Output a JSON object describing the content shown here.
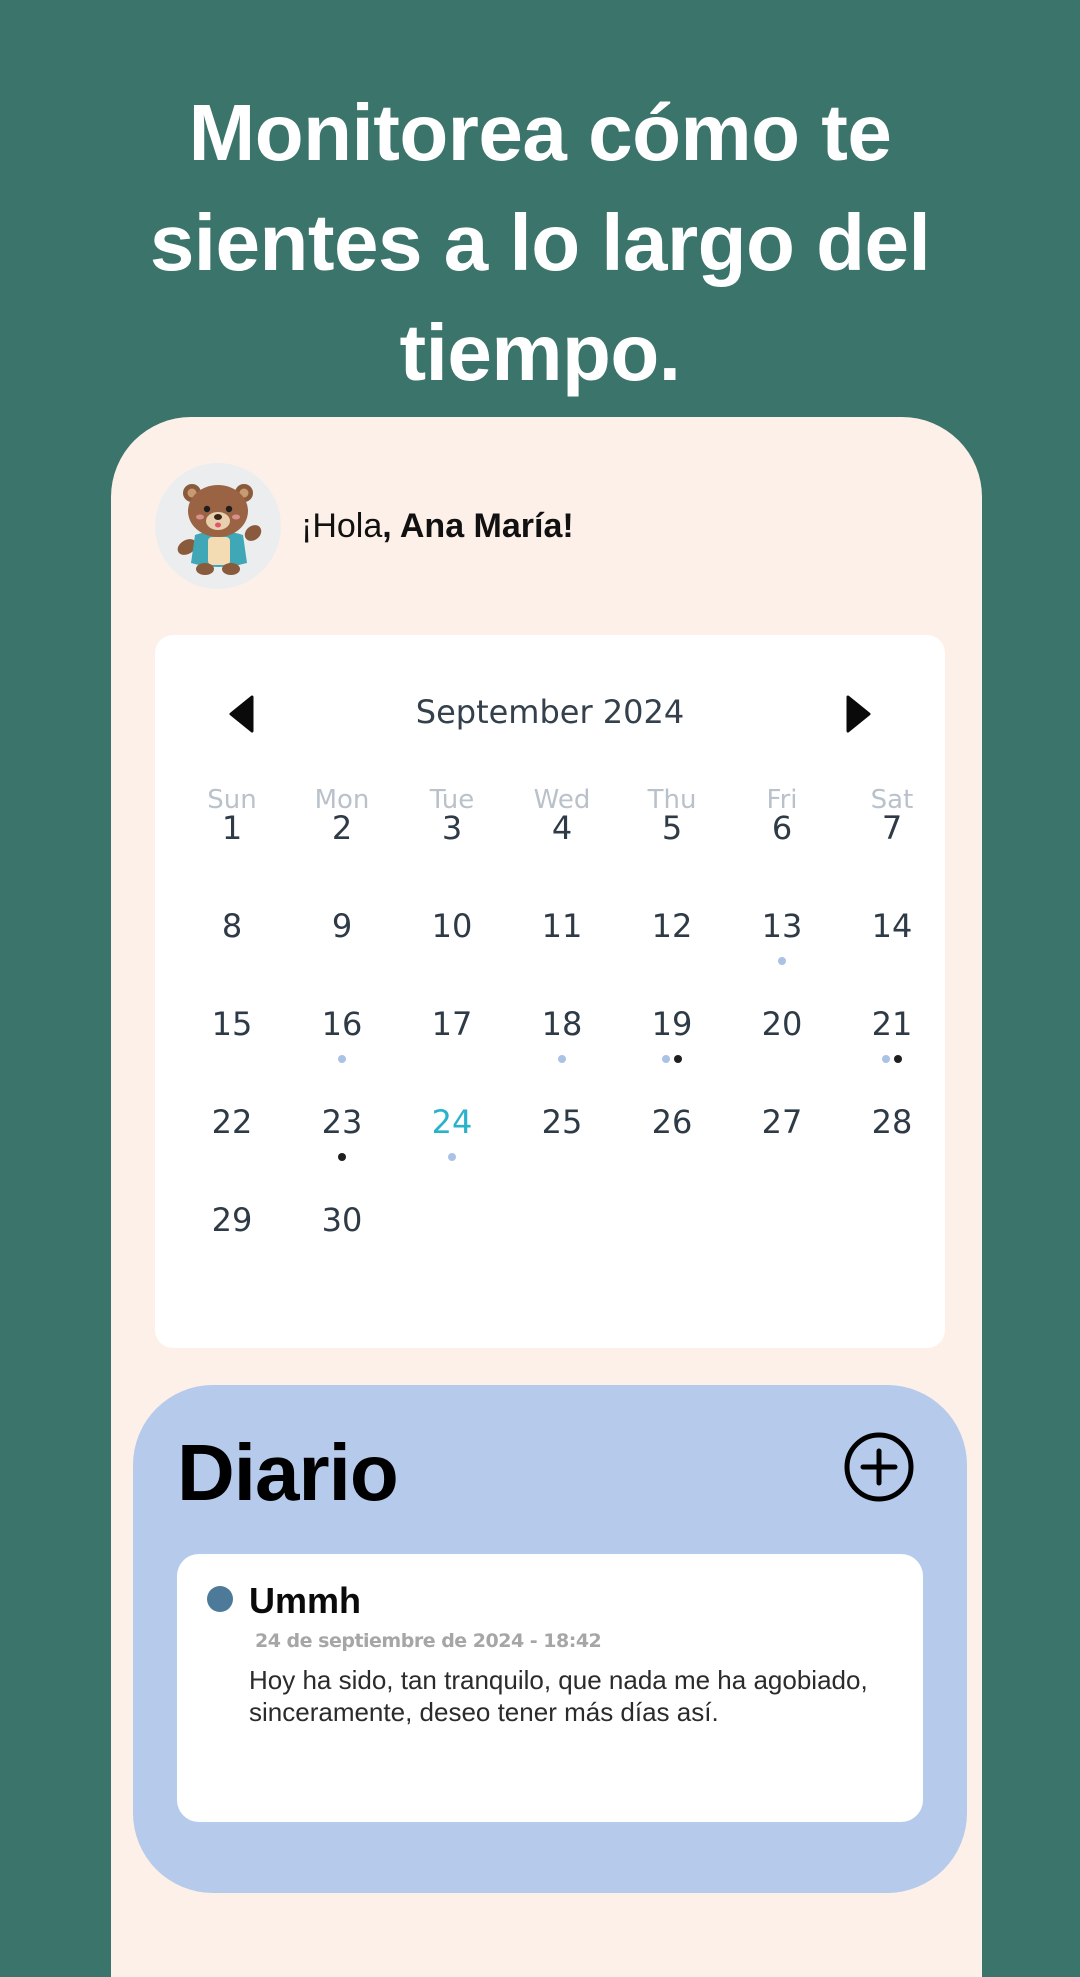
{
  "headline": "Monitorea cómo te sientes a lo largo del tiempo.",
  "greeting": {
    "prefix": "¡Hola",
    "name": ", Ana María!"
  },
  "calendar": {
    "month_label": "September 2024",
    "prev_icon": "caret-left-icon",
    "next_icon": "caret-right-icon",
    "weekdays": [
      "Sun",
      "Mon",
      "Tue",
      "Wed",
      "Thu",
      "Fri",
      "Sat"
    ],
    "weeks": [
      [
        "1",
        "2",
        "3",
        "4",
        "5",
        "6",
        "7"
      ],
      [
        "8",
        "9",
        "10",
        "11",
        "12",
        "13",
        "14"
      ],
      [
        "15",
        "16",
        "17",
        "18",
        "19",
        "20",
        "21"
      ],
      [
        "22",
        "23",
        "24",
        "25",
        "26",
        "27",
        "28"
      ],
      [
        "29",
        "30",
        "",
        "",
        "",
        "",
        ""
      ]
    ],
    "today": "24",
    "markers": {
      "13": [
        "light"
      ],
      "16": [
        "light"
      ],
      "18": [
        "light"
      ],
      "19": [
        "light",
        "dark"
      ],
      "21": [
        "light",
        "dark"
      ],
      "23": [
        "dark"
      ],
      "24": [
        "light"
      ]
    },
    "colors": {
      "today": "#2bb2cb",
      "marker_light": "#a9c2e6",
      "marker_dark": "#1f1f1f"
    }
  },
  "diario": {
    "title": "Diario",
    "add_icon": "plus-circle-icon",
    "entries": [
      {
        "title": "Ummh",
        "date": "24 de septiembre de 2024 - 18:42",
        "text": "Hoy ha sido, tan tranquilo, que nada me ha agobiado, sinceramente, deseo tener más días así.",
        "mood_color": "#4e7a99"
      }
    ]
  },
  "colors": {
    "background": "#3b746b",
    "card": "#fdf0e9",
    "diario_panel": "#b6caeb"
  }
}
